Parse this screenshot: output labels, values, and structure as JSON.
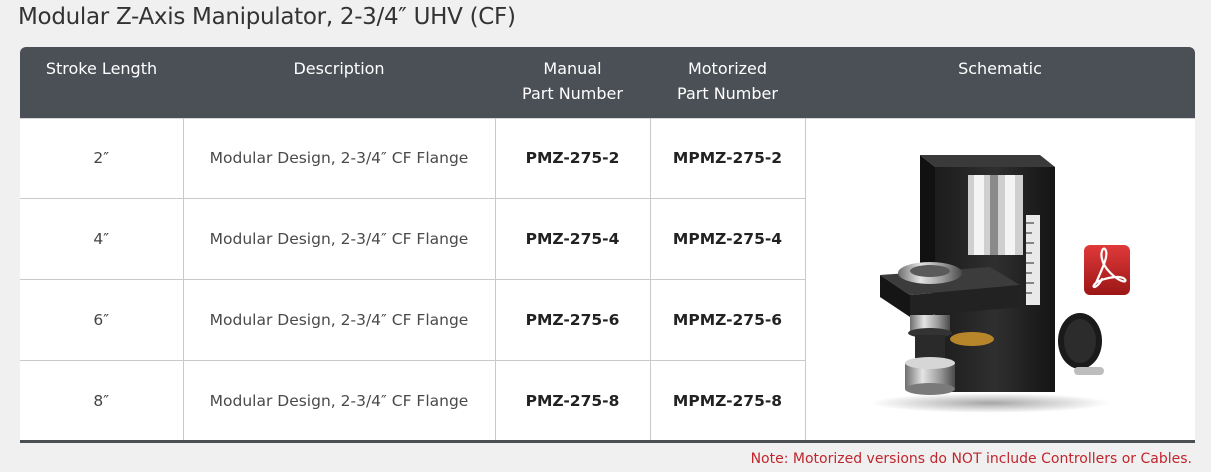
{
  "title": "Modular Z-Axis Manipulator, 2-3/4″ UHV (CF)",
  "table": {
    "headers": {
      "stroke": "Stroke Length",
      "description": "Description",
      "manual_line1": "Manual",
      "manual_line2": "Part Number",
      "motorized_line1": "Motorized",
      "motorized_line2": "Part Number",
      "schematic": "Schematic"
    },
    "rows": [
      {
        "stroke": "2″",
        "description": "Modular Design, 2-3/4″ CF Flange",
        "manual": "PMZ-275-2",
        "motorized": "MPMZ-275-2"
      },
      {
        "stroke": "4″",
        "description": "Modular Design, 2-3/4″ CF Flange",
        "manual": "PMZ-275-4",
        "motorized": "MPMZ-275-4"
      },
      {
        "stroke": "6″",
        "description": "Modular Design, 2-3/4″ CF Flange",
        "manual": "PMZ-275-6",
        "motorized": "MPMZ-275-6"
      },
      {
        "stroke": "8″",
        "description": "Modular Design, 2-3/4″ CF Flange",
        "manual": "PMZ-275-8",
        "motorized": "MPMZ-275-8"
      }
    ],
    "schematic_icon": "pdf-icon",
    "schematic_image": "z-axis-manipulator-photo"
  },
  "note": "Note: Motorized versions do NOT include Controllers or Cables.",
  "colors": {
    "header_bg": "#4b5056",
    "note": "#c0262d",
    "pdf_red": "#c8202a"
  }
}
